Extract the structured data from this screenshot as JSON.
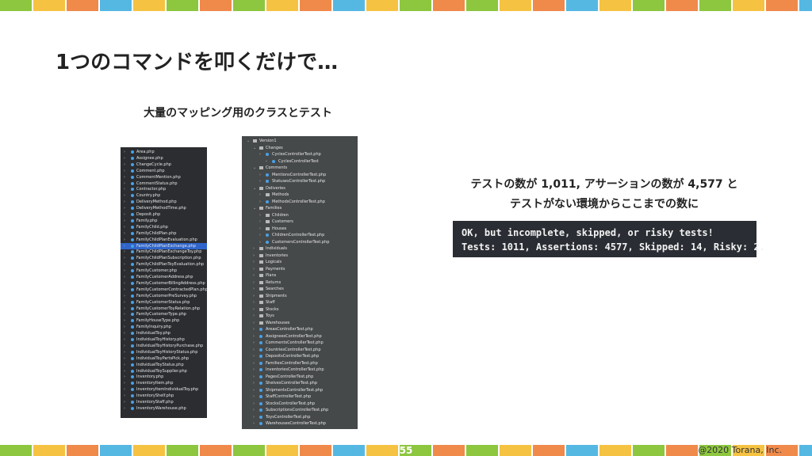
{
  "slide": {
    "title": "1つのコマンドを叩くだけで…",
    "subtitle": "大量のマッピング用のクラスとテスト",
    "description_line1": "テストの数が 1,011, アサーションの数が 4,577 と",
    "description_line2": "テストがない環境からここまでの数に",
    "page_number": "55",
    "copyright": "@2020 Torana, Inc."
  },
  "terminal": {
    "line1": "OK, but incomplete, skipped, or risky tests!",
    "line2": "Tests: 1011, Assertions: 4577, Skipped: 14, Risky: 2."
  },
  "colors": {
    "stripe": [
      "#8dc63f",
      "#f5c242",
      "#f08a4b",
      "#55b8e3",
      "#f5c242",
      "#8dc63f",
      "#f08a4b"
    ],
    "panel_left_bg": "#2b2d30",
    "panel_right_bg": "#46494a",
    "selection": "#2f65ca",
    "terminal_bg": "#2a2d33"
  },
  "file_tree_left": [
    {
      "label": "Area.php"
    },
    {
      "label": "Assignee.php"
    },
    {
      "label": "ChangeCycle.php"
    },
    {
      "label": "Comment.php"
    },
    {
      "label": "CommentMention.php"
    },
    {
      "label": "CommentStatus.php"
    },
    {
      "label": "Contractor.php"
    },
    {
      "label": "Country.php"
    },
    {
      "label": "DeliveryMethod.php"
    },
    {
      "label": "DeliveryMethodTime.php"
    },
    {
      "label": "Deposit.php"
    },
    {
      "label": "Family.php"
    },
    {
      "label": "FamilyChild.php"
    },
    {
      "label": "FamilyChildPlan.php"
    },
    {
      "label": "FamilyChildPlanEvaluation.php"
    },
    {
      "label": "FamilyChildPlanExchange.php",
      "selected": true
    },
    {
      "label": "FamilyChildPlanExchangeToy.php"
    },
    {
      "label": "FamilyChildPlanSubscription.php"
    },
    {
      "label": "FamilyChildPlanToyEvaluation.php"
    },
    {
      "label": "FamilyCustomer.php"
    },
    {
      "label": "FamilyCustomerAddress.php"
    },
    {
      "label": "FamilyCustomerBillingAddress.php"
    },
    {
      "label": "FamilyCustomerContractedPlan.php"
    },
    {
      "label": "FamilyCustomerPreSurvey.php"
    },
    {
      "label": "FamilyCustomerStatus.php"
    },
    {
      "label": "FamilyCustomerToyRelation.php"
    },
    {
      "label": "FamilyCustomerType.php"
    },
    {
      "label": "FamilyHouseType.php"
    },
    {
      "label": "FamilyInquiry.php"
    },
    {
      "label": "IndividualToy.php"
    },
    {
      "label": "IndividualToyHistory.php"
    },
    {
      "label": "IndividualToyHistoryPurchase.php"
    },
    {
      "label": "IndividualToyHistoryStatus.php"
    },
    {
      "label": "IndividualToyPartsPick.php"
    },
    {
      "label": "IndividualToyStatus.php"
    },
    {
      "label": "IndividualToySupplier.php"
    },
    {
      "label": "Inventory.php"
    },
    {
      "label": "InventoryItem.php"
    },
    {
      "label": "InventoryItemIndividualToy.php"
    },
    {
      "label": "InventoryShelf.php"
    },
    {
      "label": "InventoryStaff.php"
    },
    {
      "label": "InventoryWarehouse.php"
    }
  ],
  "file_tree_right": [
    {
      "label": "Version1",
      "kind": "folder",
      "depth": 0,
      "open": true
    },
    {
      "label": "Changes",
      "kind": "folder",
      "depth": 1,
      "open": true
    },
    {
      "label": "CyclesControllerTest.php",
      "kind": "file",
      "depth": 2
    },
    {
      "label": "CyclesControllerTest",
      "kind": "file",
      "depth": 3
    },
    {
      "label": "Comments",
      "kind": "folder",
      "depth": 1,
      "open": true
    },
    {
      "label": "MentionsControllerTest.php",
      "kind": "file",
      "depth": 2
    },
    {
      "label": "StatusesControllerTest.php",
      "kind": "file",
      "depth": 2
    },
    {
      "label": "Deliveries",
      "kind": "folder",
      "depth": 1,
      "open": true
    },
    {
      "label": "Methods",
      "kind": "folder",
      "depth": 2
    },
    {
      "label": "MethodsControllerTest.php",
      "kind": "file",
      "depth": 2
    },
    {
      "label": "Families",
      "kind": "folder",
      "depth": 1,
      "open": true
    },
    {
      "label": "Children",
      "kind": "folder",
      "depth": 2
    },
    {
      "label": "Customers",
      "kind": "folder",
      "depth": 2
    },
    {
      "label": "Houses",
      "kind": "folder",
      "depth": 2
    },
    {
      "label": "ChildrenControllerTest.php",
      "kind": "file",
      "depth": 2
    },
    {
      "label": "CustomersControllerTest.php",
      "kind": "file",
      "depth": 2
    },
    {
      "label": "Individuals",
      "kind": "folder",
      "depth": 1
    },
    {
      "label": "Inventories",
      "kind": "folder",
      "depth": 1
    },
    {
      "label": "Logicals",
      "kind": "folder",
      "depth": 1
    },
    {
      "label": "Payments",
      "kind": "folder",
      "depth": 1
    },
    {
      "label": "Plans",
      "kind": "folder",
      "depth": 1
    },
    {
      "label": "Returns",
      "kind": "folder",
      "depth": 1
    },
    {
      "label": "Searches",
      "kind": "folder",
      "depth": 1
    },
    {
      "label": "Shipments",
      "kind": "folder",
      "depth": 1
    },
    {
      "label": "Staff",
      "kind": "folder",
      "depth": 1
    },
    {
      "label": "Stocks",
      "kind": "folder",
      "depth": 1
    },
    {
      "label": "Toys",
      "kind": "folder",
      "depth": 1
    },
    {
      "label": "Warehouses",
      "kind": "folder",
      "depth": 1
    },
    {
      "label": "AreasControllerTest.php",
      "kind": "file",
      "depth": 1
    },
    {
      "label": "AssigneesControllerTest.php",
      "kind": "file",
      "depth": 1
    },
    {
      "label": "CommentsControllerTest.php",
      "kind": "file",
      "depth": 1
    },
    {
      "label": "CountriesControllerTest.php",
      "kind": "file",
      "depth": 1
    },
    {
      "label": "DepositsControllerTest.php",
      "kind": "file",
      "depth": 1
    },
    {
      "label": "FamiliesControllerTest.php",
      "kind": "file",
      "depth": 1
    },
    {
      "label": "InventoriesControllerTest.php",
      "kind": "file",
      "depth": 1
    },
    {
      "label": "PagesControllerTest.php",
      "kind": "file",
      "depth": 1
    },
    {
      "label": "ShelvesControllerTest.php",
      "kind": "file",
      "depth": 1
    },
    {
      "label": "ShipmentsControllerTest.php",
      "kind": "file",
      "depth": 1
    },
    {
      "label": "StaffControllerTest.php",
      "kind": "file",
      "depth": 1
    },
    {
      "label": "StocksControllerTest.php",
      "kind": "file",
      "depth": 1
    },
    {
      "label": "SubscriptionsControllerTest.php",
      "kind": "file",
      "depth": 1
    },
    {
      "label": "ToysControllerTest.php",
      "kind": "file",
      "depth": 1
    },
    {
      "label": "WarehousesControllerTest.php",
      "kind": "file",
      "depth": 1
    }
  ]
}
